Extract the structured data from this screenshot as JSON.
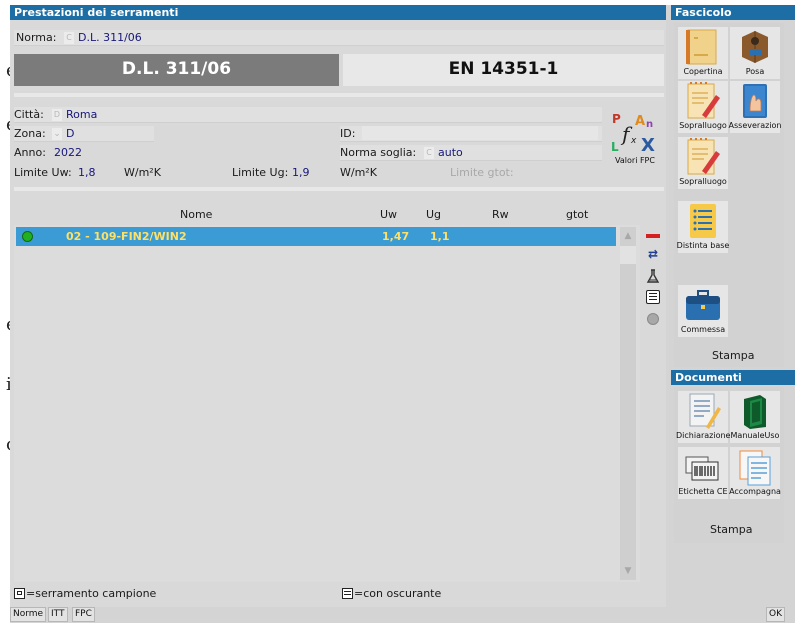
{
  "background_margin_text": [
    "e",
    "e",
    "e",
    "i",
    "o"
  ],
  "window": {
    "title": "Prestazioni dei serramenti",
    "norma": {
      "label": "Norma:",
      "badge": "C",
      "value": "D.L. 311/06"
    },
    "norm_buttons": {
      "selected": "D.L. 311/06",
      "other": "EN 14351-1"
    },
    "params": {
      "citta": {
        "label": "Città:",
        "badge": "D",
        "value": "Roma"
      },
      "zona": {
        "label": "Zona:",
        "value": "D"
      },
      "anno": {
        "label": "Anno:",
        "value": "2022"
      },
      "id": {
        "label": "ID:",
        "value": ""
      },
      "norma_soglia": {
        "label": "Norma soglia:",
        "badge": "C",
        "value": "auto"
      },
      "limite_uw": {
        "label": "Limite Uw:",
        "value": "1,8",
        "unit": "W/m²K"
      },
      "limite_ug": {
        "label": "Limite Ug:",
        "value": "1,9",
        "unit": "W/m²K"
      },
      "limite_gtot": {
        "label": "Limite gtot:"
      },
      "valori_fpc": "Valori FPC"
    },
    "table": {
      "headers": [
        "Nome",
        "Uw",
        "Ug",
        "Rw",
        "gtot"
      ],
      "rows": [
        {
          "status": "green",
          "nome": "02 - 109-FIN2/WIN2",
          "uw": "1,47",
          "ug": "1,1",
          "rw": "",
          "gtot": ""
        }
      ]
    },
    "legend": {
      "sample": "=serramento campione",
      "shutter": "=con oscurante"
    }
  },
  "fascicolo": {
    "title": "Fascicolo",
    "tiles": [
      {
        "label": "Copertina",
        "icon": "cover-icon"
      },
      {
        "label": "Posa",
        "icon": "box-icon"
      },
      {
        "label": "Sopralluogo",
        "icon": "notepad-pencil-icon"
      },
      {
        "label": "Asseverazion",
        "icon": "hand-book-icon"
      },
      {
        "label": "Sopralluogo",
        "icon": "notepad-pencil-icon"
      },
      {
        "label": "Distinta base",
        "icon": "checklist-icon"
      },
      {
        "label": "Commessa",
        "icon": "briefcase-icon"
      }
    ],
    "stampa": "Stampa"
  },
  "documenti": {
    "title": "Documenti",
    "tiles": [
      {
        "label": "Dichiarazione",
        "icon": "document-pencil-icon"
      },
      {
        "label": "ManualeUso",
        "icon": "green-book-icon"
      },
      {
        "label": "Etichetta CE",
        "icon": "barcode-label-icon"
      },
      {
        "label": "Accompagna",
        "icon": "forms-icon"
      }
    ],
    "stampa": "Stampa"
  },
  "bottom_bar": {
    "buttons": [
      "Norme",
      "ITT",
      "FPC"
    ],
    "ok": "OK"
  },
  "colors": {
    "title_bar": "#1c6ea4",
    "selected_row": "#3a9bd5",
    "selected_text": "#ffe066",
    "status_green": "#22b022"
  }
}
